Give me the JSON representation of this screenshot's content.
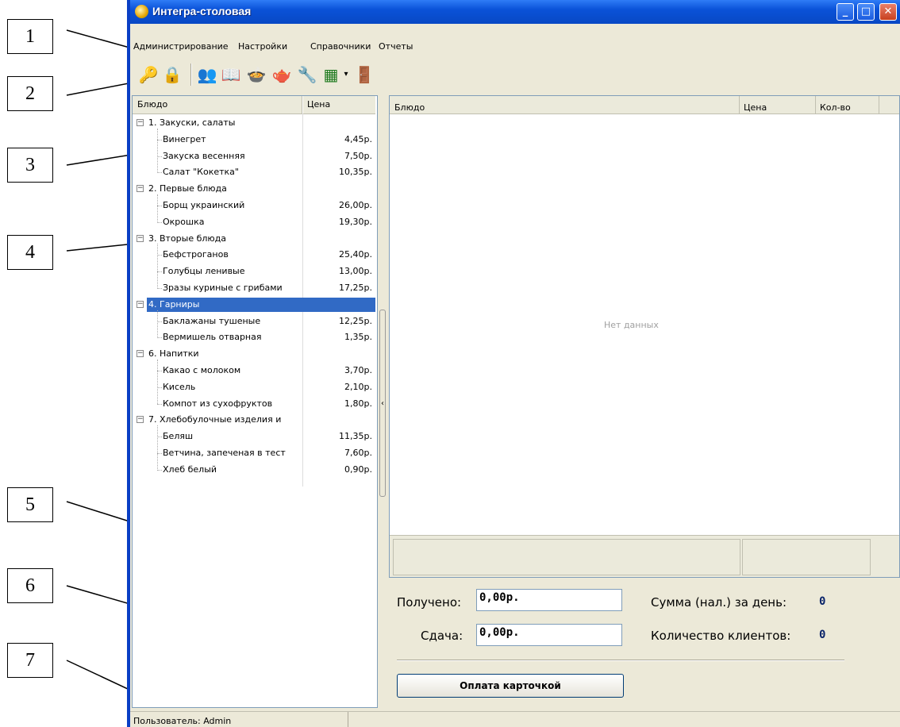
{
  "callouts": [
    "1",
    "2",
    "3",
    "4",
    "5",
    "6",
    "7"
  ],
  "window": {
    "title": "Интегра-столовая",
    "menu": [
      "Администрирование",
      "Настройки",
      "Справочники",
      "Отчеты"
    ],
    "toolbar_icons": [
      "keys-search-icon",
      "lock-icon",
      "users-icon",
      "book-icon",
      "dishes-icon",
      "pot-icon",
      "tools-icon",
      "excel-icon",
      "dropdown-arrow-icon",
      "exit-door-icon"
    ]
  },
  "menu_grid": {
    "headers": [
      "Блюдо",
      "Цена"
    ],
    "groups": [
      {
        "name": "1. Закуски, салаты",
        "items": [
          [
            "Винегрет",
            "4,45р."
          ],
          [
            "Закуска весенняя",
            "7,50р."
          ],
          [
            "Салат \"Кокетка\"",
            "10,35р."
          ]
        ]
      },
      {
        "name": "2. Первые блюда",
        "items": [
          [
            "Борщ украинский",
            "26,00р."
          ],
          [
            "Окрошка",
            "19,30р."
          ]
        ]
      },
      {
        "name": "3. Вторые блюда",
        "items": [
          [
            "Бефстроганов",
            "25,40р."
          ],
          [
            "Голубцы ленивые",
            "13,00р."
          ],
          [
            "Зразы куриные с грибами",
            "17,25р."
          ]
        ]
      },
      {
        "name": "4. Гарниры",
        "selected": true,
        "items": [
          [
            "Баклажаны тушеные",
            "12,25р."
          ],
          [
            "Вермишель отварная",
            "1,35р."
          ]
        ]
      },
      {
        "name": "6. Напитки",
        "items": [
          [
            "Какао с молоком",
            "3,70р."
          ],
          [
            "Кисель",
            "2,10р."
          ],
          [
            "Компот из сухофруктов",
            "1,80р."
          ]
        ]
      },
      {
        "name": "7. Хлебобулочные изделия и",
        "items": [
          [
            "Беляш",
            "11,35р."
          ],
          [
            "Ветчина, запеченая в тест",
            "7,60р."
          ],
          [
            "Хлеб белый",
            "0,90р."
          ]
        ]
      }
    ]
  },
  "order_grid": {
    "headers": [
      "Блюдо",
      "Цена",
      "Кол-во"
    ],
    "empty_text": "Нет данных"
  },
  "payment": {
    "received_label": "Получено:",
    "received_value": "0,00р.",
    "change_label": "Сдача:",
    "change_value": "0,00р.",
    "day_sum_label": "Сумма (нал.) за день:",
    "day_sum_value": "0",
    "clients_label": "Количество клиентов:",
    "clients_value": "0",
    "card_button": "Оплата карточкой"
  },
  "status": {
    "user": "Пользователь: Admin"
  }
}
